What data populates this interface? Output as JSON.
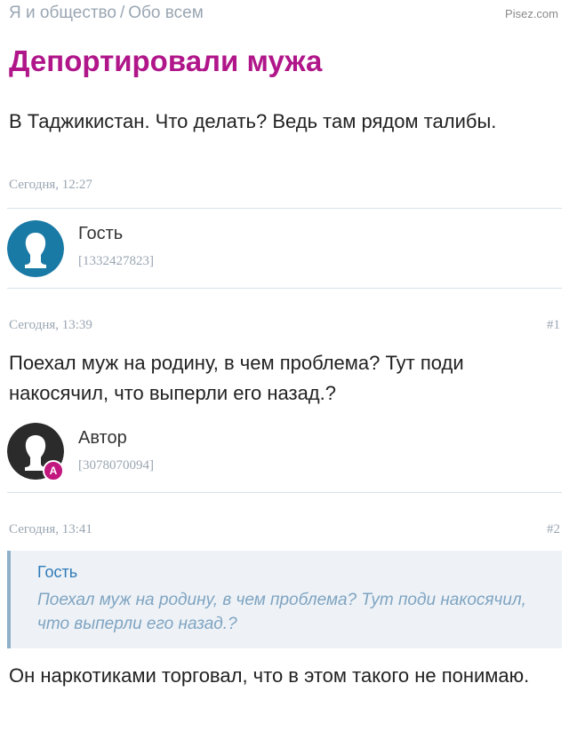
{
  "breadcrumb": {
    "section": "Я и общество",
    "separator": "/",
    "subsection": "Обо всем"
  },
  "watermark": "Pisez.com",
  "topic": {
    "title": "Депортировали мужа",
    "text": "В Таджикистан. Что делать? Ведь там рядом талибы.",
    "date": "Сегодня, 12:27",
    "author": {
      "name": "Гость",
      "id": "[1332427823]",
      "avatar_color": "#1a7aa6"
    }
  },
  "posts": [
    {
      "date": "Сегодня, 13:39",
      "number": "#1",
      "text": "Поехал муж на родину, в чем проблема? Тут поди накосячил, что выперли его назад.?",
      "author": {
        "name": "Автор",
        "id": "[3078070094]",
        "badge": "А",
        "avatar_color": "#2b2b2b"
      }
    },
    {
      "date": "Сегодня, 13:41",
      "number": "#2",
      "quote": {
        "author": "Гость",
        "text": "Поехал муж на родину, в чем проблема? Тут поди накосячил, что выперли его назад.?"
      },
      "text": "Он наркотиками торговал, что в этом такого не понимаю."
    }
  ],
  "colors": {
    "title": "#b0168a",
    "meta": "#9aa6b2",
    "quote_author": "#2f7ab8",
    "badge": "#c2177f"
  }
}
